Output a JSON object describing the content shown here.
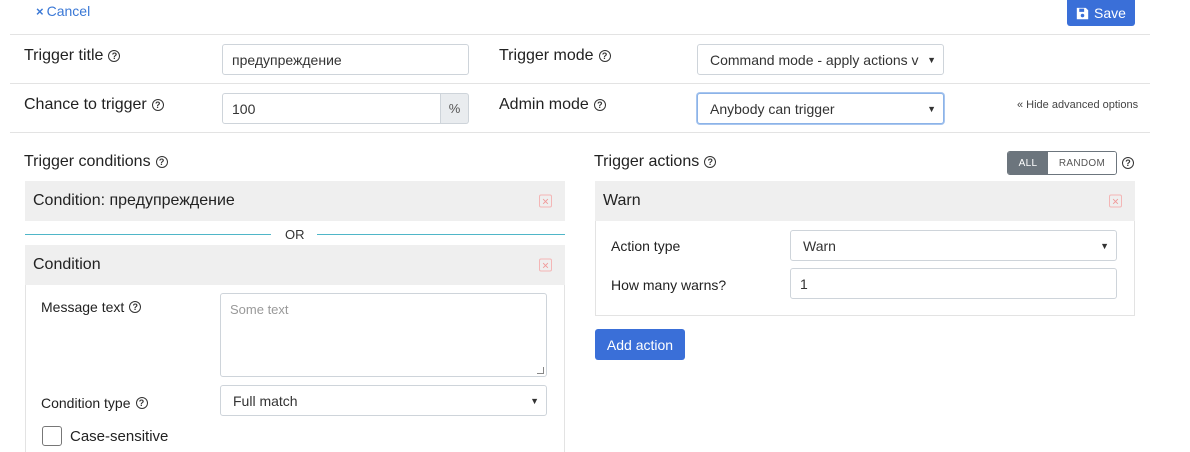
{
  "header": {
    "cancel_label": "Cancel",
    "save_label": "Save"
  },
  "settings": {
    "trigger_title_label": "Trigger title",
    "trigger_title_value": "предупреждение",
    "trigger_mode_label": "Trigger mode",
    "trigger_mode_value": "Command mode - apply actions v",
    "chance_label": "Chance to trigger",
    "chance_value": "100",
    "chance_unit": "%",
    "admin_mode_label": "Admin mode",
    "admin_mode_value": "Anybody can trigger",
    "hide_advanced": "« Hide advanced options"
  },
  "conditions": {
    "heading": "Trigger conditions",
    "collapsed_title": "Condition: предупреждение",
    "separator": "OR",
    "open_title": "Condition",
    "message_text_label": "Message text",
    "message_text_placeholder": "Some text",
    "condition_type_label": "Condition type",
    "condition_type_value": "Full match",
    "case_sensitive_label": "Case-sensitive"
  },
  "actions": {
    "heading": "Trigger actions",
    "toggle_all": "ALL",
    "toggle_random": "RANDOM",
    "card_title": "Warn",
    "action_type_label": "Action type",
    "action_type_value": "Warn",
    "warns_label": "How many warns?",
    "warns_value": "1",
    "add_action_label": "Add action"
  },
  "colors": {
    "primary": "#3a6fd8",
    "separator_line": "#4fb6c8",
    "toggle_active": "#6c757d"
  },
  "icons": {
    "cancel": "close-icon",
    "save": "floppy-disk-icon",
    "help": "question-circle-icon",
    "delete": "delete-x-icon",
    "dropdown": "caret-down-icon"
  }
}
